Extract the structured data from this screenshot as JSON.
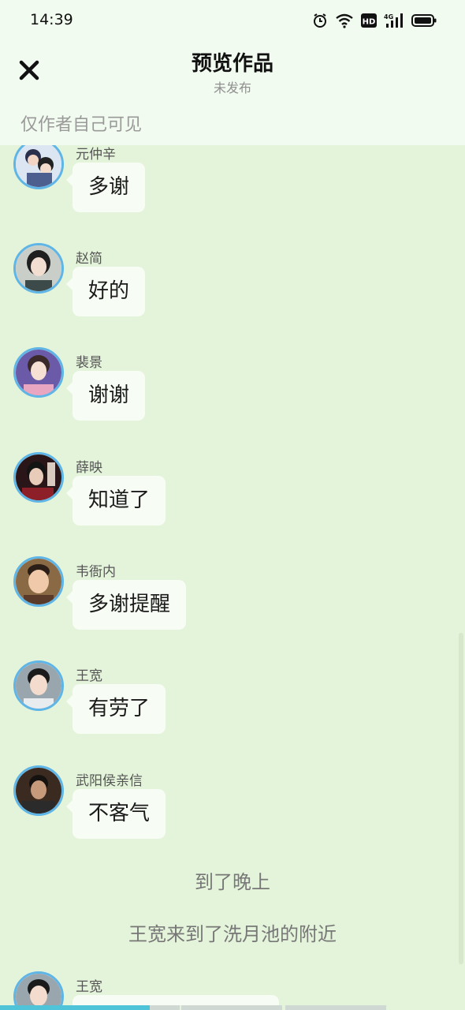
{
  "status_bar": {
    "time": "14:39",
    "icons": [
      "alarm-icon",
      "wifi-icon",
      "hd-icon",
      "4g-signal-icon",
      "battery-icon"
    ],
    "hd_text": "HD",
    "network_text": "4G"
  },
  "header": {
    "close_icon": "close-icon",
    "title": "预览作品",
    "subtitle": "未发布",
    "visibility": "仅作者自己可见"
  },
  "colors": {
    "background": "#e4f4da",
    "header_bg": "#f2fbef",
    "bubble_bg": "#f7fcf4",
    "avatar_border": "#5eb5e6",
    "progress": "#4fc3d8"
  },
  "messages": [
    {
      "name": "元仲辛",
      "text": "多谢"
    },
    {
      "name": "赵简",
      "text": "好的"
    },
    {
      "name": "裴景",
      "text": "谢谢"
    },
    {
      "name": "薛映",
      "text": "知道了"
    },
    {
      "name": "韦衙内",
      "text": "多谢提醒"
    },
    {
      "name": "王宽",
      "text": "有劳了"
    },
    {
      "name": "武阳侯亲信",
      "text": "不客气"
    }
  ],
  "narrations": [
    "到了晚上",
    "王宽来到了洗月池的附近"
  ],
  "last_message": {
    "name": "王宽",
    "text": ""
  }
}
